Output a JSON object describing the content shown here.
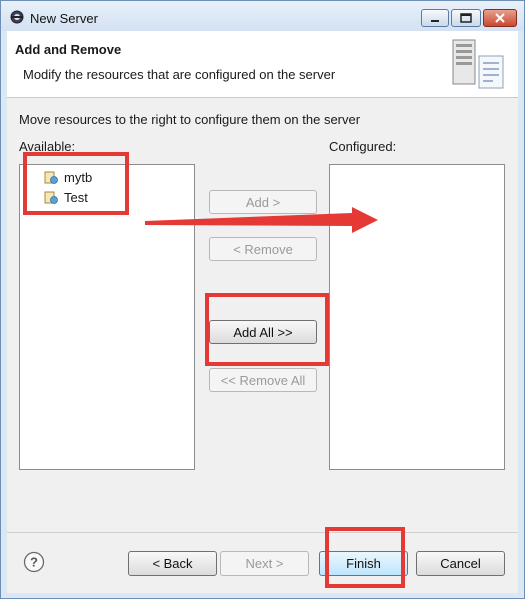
{
  "window": {
    "title": "New Server",
    "accent": "#4a7ebb",
    "controls": [
      "minimize-icon",
      "maximize-icon",
      "close-icon"
    ]
  },
  "header": {
    "title": "Add and Remove",
    "description": "Modify the resources that are configured on the server",
    "art_icon": "server-graphic-icon"
  },
  "main": {
    "instruction": "Move resources to the right to configure them on the server",
    "available_label": "Available:",
    "configured_label": "Configured:",
    "available_items": [
      {
        "label": "mytb",
        "icon": "web-module-icon"
      },
      {
        "label": "Test",
        "icon": "web-module-icon"
      }
    ],
    "configured_items": [],
    "buttons": {
      "add": "Add >",
      "remove": "< Remove",
      "add_all": "Add All >>",
      "remove_all": "<< Remove All"
    }
  },
  "footer": {
    "help_icon": "help-icon",
    "back": "< Back",
    "next": "Next >",
    "finish": "Finish",
    "cancel": "Cancel"
  },
  "annotations": {
    "color": "#e53935"
  }
}
